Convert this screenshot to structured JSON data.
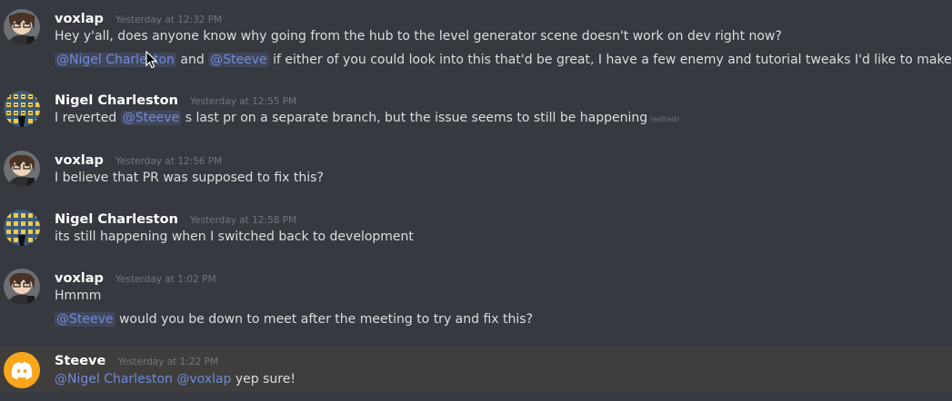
{
  "messages": [
    {
      "username": "voxlap",
      "timestamp": "Yesterday at 12:32 PM",
      "lines": [
        {
          "text": "Hey y'all, does anyone know why going from the hub to the level generator scene doesn't work on dev right now?"
        },
        {
          "mention1": "@Nigel Charleston",
          "t1": " and ",
          "mention2": "@Steeve",
          "t2": " if either of you could look into this that'd be great, I have a few enemy and tutorial tweaks I'd like to make"
        }
      ]
    },
    {
      "username": "Nigel Charleston",
      "timestamp": "Yesterday at 12:55 PM",
      "lines": [
        {
          "t0": "I reverted ",
          "mention": "@Steeve",
          "t1": " s last pr on a separate branch, but the issue seems to still be happening",
          "edited": "(edited)"
        }
      ]
    },
    {
      "username": "voxlap",
      "timestamp": "Yesterday at 12:56 PM",
      "lines": [
        {
          "text": "I believe that PR was supposed to fix this?"
        }
      ]
    },
    {
      "username": "Nigel Charleston",
      "timestamp": "Yesterday at 12:58 PM",
      "lines": [
        {
          "text": "its still happening when I switched back to development"
        }
      ]
    },
    {
      "username": "voxlap",
      "timestamp": "Yesterday at 1:02 PM",
      "lines": [
        {
          "text": "Hmmm"
        },
        {
          "mention": "@Steeve",
          "t1": " would you be down to meet after the meeting to try and fix this?"
        }
      ]
    },
    {
      "username": "Steeve",
      "timestamp": "Yesterday at 1:22 PM",
      "lines": [
        {
          "mention1": "@Nigel Charleston",
          "mention2": "@voxlap",
          "t1": " yep sure!"
        }
      ]
    }
  ],
  "colors": {
    "background": "#36393f",
    "highlight": "#3f3e3d",
    "mention": "#7289da",
    "username": "#ffffff",
    "timestamp": "#72767d",
    "discord_avatar": "#faa61a"
  },
  "icons": {
    "voxlap_avatar": "anime-avatar-icon",
    "nigel_avatar": "pattern-avatar-icon",
    "steeve_avatar": "discord-logo-icon",
    "cursor": "mouse-pointer-icon"
  }
}
